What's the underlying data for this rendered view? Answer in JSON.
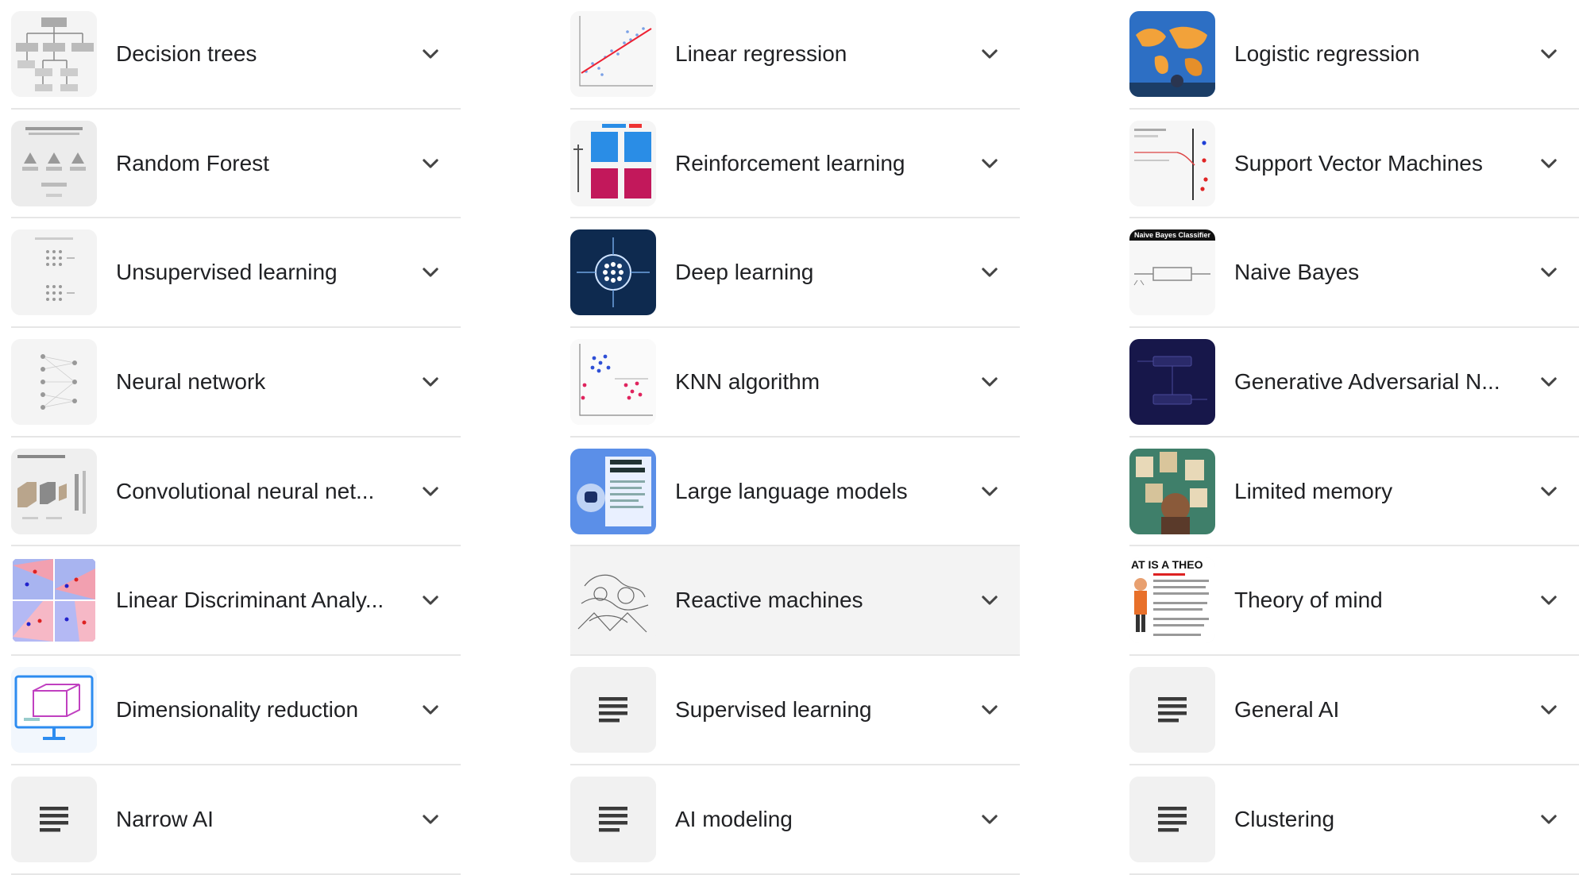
{
  "columns": [
    {
      "items": [
        {
          "label": "Decision trees",
          "thumb": "decision-tree-diagram"
        },
        {
          "label": "Random Forest",
          "thumb": "random-forest-diagram"
        },
        {
          "label": "Unsupervised learning",
          "thumb": "unsupervised-diagram"
        },
        {
          "label": "Neural network",
          "thumb": "neural-network-diagram"
        },
        {
          "label": "Convolutional neural net...",
          "thumb": "cnn-diagram"
        },
        {
          "label": "Linear Discriminant Analy...",
          "thumb": "lda-plots"
        },
        {
          "label": "Dimensionality reduction",
          "thumb": "monitor-cube-image"
        },
        {
          "label": "Narrow AI",
          "thumb": "text-lines-icon"
        }
      ]
    },
    {
      "items": [
        {
          "label": "Linear regression",
          "thumb": "scatter-regression-plot"
        },
        {
          "label": "Reinforcement learning",
          "thumb": "reinforcement-diagram"
        },
        {
          "label": "Deep learning",
          "thumb": "deep-learning-image"
        },
        {
          "label": "KNN algorithm",
          "thumb": "knn-scatter-plot"
        },
        {
          "label": "Large language models",
          "thumb": "llm-image"
        },
        {
          "label": "Reactive machines",
          "thumb": "reactive-sketch"
        },
        {
          "label": "Supervised learning",
          "thumb": "text-lines-icon"
        },
        {
          "label": "AI modeling",
          "thumb": "text-lines-icon"
        }
      ]
    },
    {
      "items": [
        {
          "label": "Logistic regression",
          "thumb": "world-map-image"
        },
        {
          "label": "Support Vector Machines",
          "thumb": "svm-diagram"
        },
        {
          "label": "Naive Bayes",
          "thumb": "naive-bayes-diagram",
          "thumb_text": "Naive Bayes Classifier"
        },
        {
          "label": "Generative Adversarial N...",
          "thumb": "gan-diagram"
        },
        {
          "label": "Limited memory",
          "thumb": "photo-collage-image"
        },
        {
          "label": "Theory of mind",
          "thumb": "theory-infographic",
          "thumb_text": "AT IS A THEO"
        },
        {
          "label": "General AI",
          "thumb": "text-lines-icon"
        },
        {
          "label": "Clustering",
          "thumb": "text-lines-icon"
        }
      ]
    }
  ],
  "highlighted": {
    "column": 1,
    "row": 5
  },
  "icons": {
    "expand": "chevron-down-icon",
    "placeholder": "text-lines-icon"
  },
  "colors": {
    "text": "#202124",
    "divider": "#e6e6e6",
    "highlight": "#f3f3f3",
    "placeholder_bg": "#f1f1f1"
  }
}
